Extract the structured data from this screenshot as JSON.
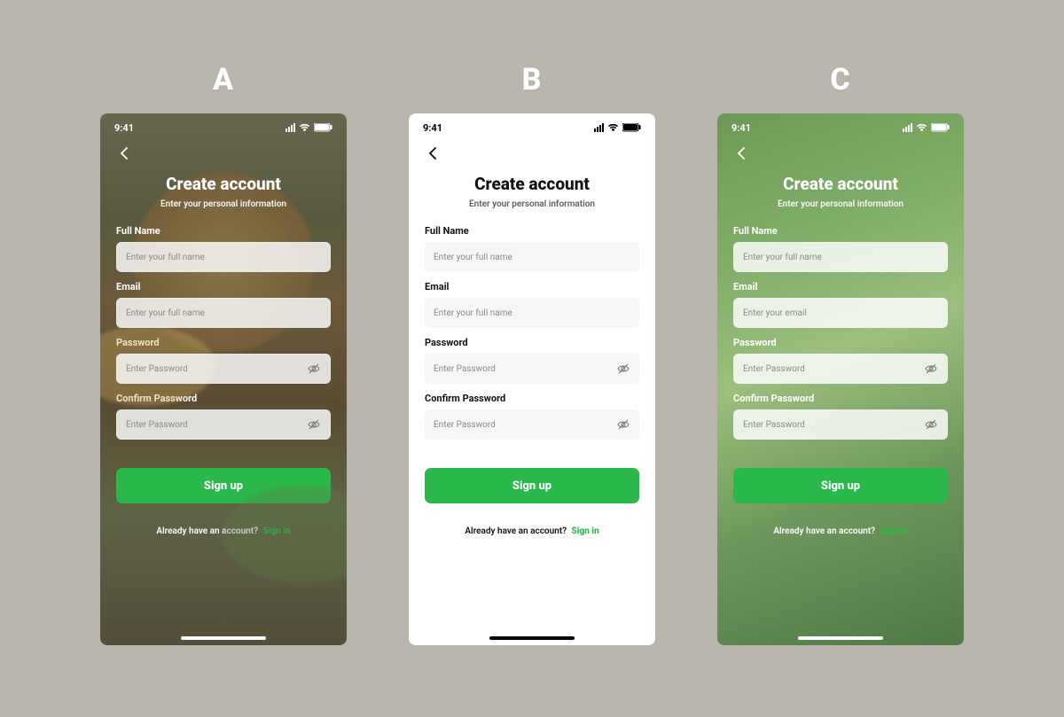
{
  "variant_labels": {
    "a": "A",
    "b": "B",
    "c": "C"
  },
  "statusbar": {
    "time": "9:41"
  },
  "header": {
    "title": "Create account",
    "subtitle": "Enter your personal information"
  },
  "fields": {
    "full_name": {
      "label": "Full Name",
      "placeholder": "Enter your full name"
    },
    "email": {
      "label": "Email"
    },
    "email_placeholder_ab": "Enter your full name",
    "email_placeholder_c": "Enter your email",
    "password": {
      "label": "Password",
      "placeholder": "Enter Password"
    },
    "confirm": {
      "label": "Confirm Password",
      "placeholder": "Enter Password"
    }
  },
  "cta": {
    "signup": "Sign up"
  },
  "footer": {
    "prefix": "Already have an account?",
    "signin": "Sign in"
  },
  "colors": {
    "accent": "#2ab84a"
  }
}
